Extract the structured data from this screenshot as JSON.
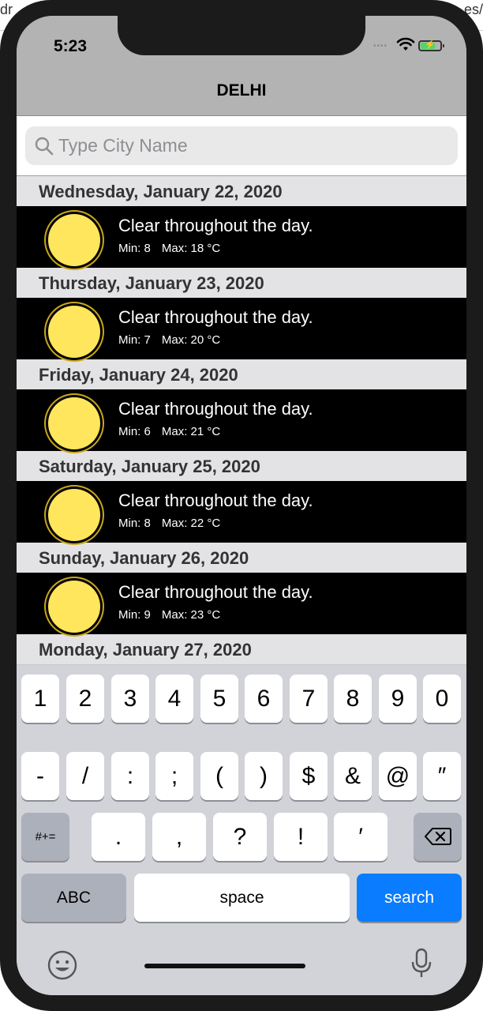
{
  "background": {
    "left_text": "dr",
    "right_text": "es/"
  },
  "status_bar": {
    "time": "5:23"
  },
  "header": {
    "city": "DELHI"
  },
  "search": {
    "placeholder": "Type City Name",
    "value": ""
  },
  "forecast": [
    {
      "date": "Wednesday, January 22, 2020",
      "summary": "Clear throughout the day.",
      "min_label": "Min: 8",
      "max_label": "Max: 18 °C",
      "icon": "sun-icon"
    },
    {
      "date": "Thursday, January 23, 2020",
      "summary": "Clear throughout the day.",
      "min_label": "Min: 7",
      "max_label": "Max: 20 °C",
      "icon": "sun-icon"
    },
    {
      "date": "Friday, January 24, 2020",
      "summary": "Clear throughout the day.",
      "min_label": "Min: 6",
      "max_label": "Max: 21 °C",
      "icon": "sun-icon"
    },
    {
      "date": "Saturday, January 25, 2020",
      "summary": "Clear throughout the day.",
      "min_label": "Min: 8",
      "max_label": "Max: 22 °C",
      "icon": "sun-icon"
    },
    {
      "date": "Sunday, January 26, 2020",
      "summary": "Clear throughout the day.",
      "min_label": "Min: 9",
      "max_label": "Max: 23 °C",
      "icon": "sun-icon"
    },
    {
      "date": "Monday, January 27, 2020"
    }
  ],
  "keyboard": {
    "row1": [
      "1",
      "2",
      "3",
      "4",
      "5",
      "6",
      "7",
      "8",
      "9",
      "0"
    ],
    "row2": [
      "-",
      "/",
      ":",
      ";",
      "(",
      ")",
      "$",
      "&",
      "@",
      "″"
    ],
    "row3_toggle": "#+=",
    "row3": [
      ".",
      ",",
      "?",
      "!",
      "′"
    ],
    "abc": "ABC",
    "space": "space",
    "search": "search"
  },
  "colors": {
    "sun": "#ffe65c",
    "search_key": "#0a7cff",
    "battery": "#4cd964"
  }
}
